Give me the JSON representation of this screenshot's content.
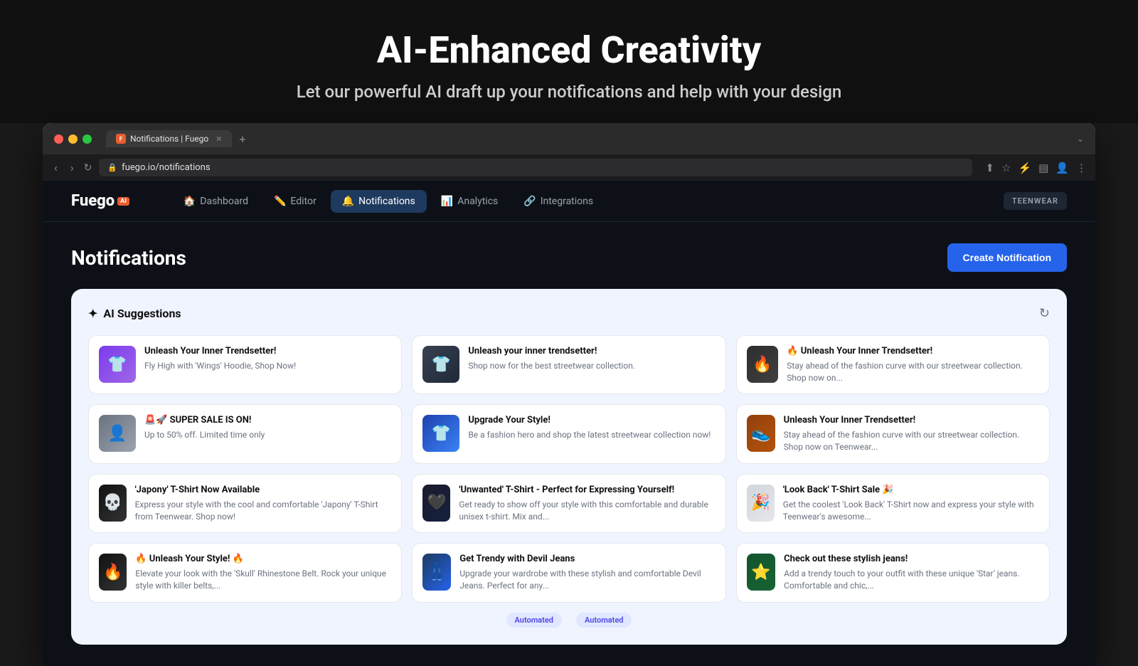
{
  "hero": {
    "title": "AI-Enhanced Creativity",
    "subtitle": "Let our powerful AI draft up your notifications and help with your design"
  },
  "browser": {
    "tab_title": "Notifications | Fuego",
    "url": "fuego.io/notifications",
    "tab_new_label": "+",
    "tab_chevron": "⌄"
  },
  "nav": {
    "logo": "Fuego",
    "logo_badge": "AI",
    "links": [
      {
        "id": "dashboard",
        "label": "Dashboard",
        "icon": "🏠",
        "active": false
      },
      {
        "id": "editor",
        "label": "Editor",
        "icon": "✏️",
        "active": false
      },
      {
        "id": "notifications",
        "label": "Notifications",
        "icon": "🔔",
        "active": true
      },
      {
        "id": "analytics",
        "label": "Analytics",
        "icon": "📊",
        "active": false
      },
      {
        "id": "integrations",
        "label": "Integrations",
        "icon": "🔗",
        "active": false
      }
    ],
    "store_badge": "TEENWEAR"
  },
  "page": {
    "title": "Notifications",
    "create_button": "Create Notification"
  },
  "ai_panel": {
    "title": "AI Suggestions",
    "sparkle": "✦",
    "refresh_tooltip": "Refresh suggestions",
    "suggestions": [
      {
        "id": 1,
        "img_class": "img-purple",
        "img_icon": "👕",
        "title": "Unleash Your Inner Trendsetter!",
        "desc": "Fly High with 'Wings' Hoodie, Shop Now!"
      },
      {
        "id": 2,
        "img_class": "img-tshirt",
        "img_icon": "👕",
        "title": "Unleash your inner trendsetter!",
        "desc": "Shop now for the best streetwear collection."
      },
      {
        "id": 3,
        "img_class": "img-dark2",
        "img_icon": "🔥",
        "title": "🔥 Unleash Your Inner Trendsetter!",
        "desc": "Stay ahead of the fashion curve with our streetwear collection. Shop now on..."
      },
      {
        "id": 4,
        "img_class": "img-gray",
        "img_icon": "👤",
        "title": "🚨🚀 SUPER SALE IS ON!",
        "desc": "Up to 50% off. Limited time only"
      },
      {
        "id": 5,
        "img_class": "img-blue",
        "img_icon": "👕",
        "title": "Upgrade Your Style!",
        "desc": "Be a fashion hero and shop the latest streetwear collection now!"
      },
      {
        "id": 6,
        "img_class": "img-stairs",
        "img_icon": "👟",
        "title": "Unleash Your Inner Trendsetter!",
        "desc": "Stay ahead of the fashion curve with our streetwear collection. Shop now on Teenwear..."
      },
      {
        "id": 7,
        "img_class": "img-skull",
        "img_icon": "💀",
        "title": "'Japony' T-Shirt Now Available",
        "desc": "Express your style with the cool and comfortable 'Japony' T-Shirt from Teenwear. Shop now!"
      },
      {
        "id": 8,
        "img_class": "img-dark1",
        "img_icon": "🖤",
        "title": "'Unwanted' T-Shirt - Perfect for Expressing Yourself!",
        "desc": "Get ready to show off your style with this comfortable and durable unisex t-shirt. Mix and..."
      },
      {
        "id": 9,
        "img_class": "img-light",
        "img_icon": "🎉",
        "title": "'Look Back' T-Shirt Sale 🎉",
        "desc": "Get the coolest 'Look Back' T-Shirt now and express your style with Teenwear's awesome..."
      },
      {
        "id": 10,
        "img_class": "img-skull",
        "img_icon": "🔥",
        "title": "🔥 Unleash Your Style! 🔥",
        "desc": "Elevate your look with the 'Skull' Rhinestone Belt. Rock your unique style with killer belts,..."
      },
      {
        "id": 11,
        "img_class": "img-jeans",
        "img_icon": "👖",
        "title": "Get Trendy with Devil Jeans",
        "desc": "Upgrade your wardrobe with these stylish and comfortable Devil Jeans. Perfect for any..."
      },
      {
        "id": 12,
        "img_class": "img-star",
        "img_icon": "⭐",
        "title": "Check out these stylish jeans!",
        "desc": "Add a trendy touch to your outfit with these unique 'Star' jeans. Comfortable and chic,..."
      }
    ],
    "bottom_badges": [
      "Automated",
      "Automated"
    ]
  }
}
